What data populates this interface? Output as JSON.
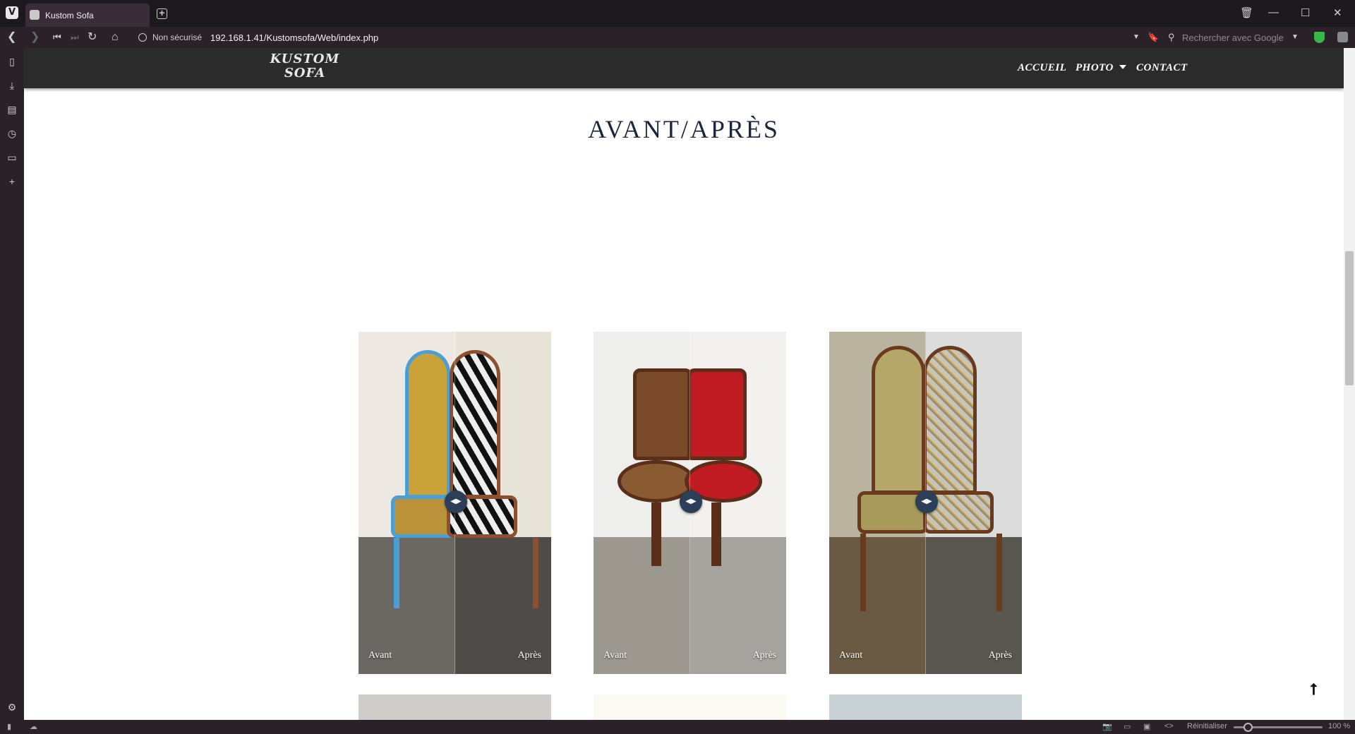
{
  "browser": {
    "tab_title": "Kustom Sofa",
    "new_tab_symbol": "+",
    "security_label": "Non sécurisé",
    "url": "192.168.1.41/Kustomsofa/Web/index.php",
    "search_placeholder": "Rechercher avec Google",
    "status": {
      "reset_label": "Réinitialiser",
      "zoom": "100 %"
    }
  },
  "site": {
    "logo_line1": "KUSTOM",
    "logo_line2": "SOFA",
    "nav": {
      "home": "ACCUEIL",
      "photo": "PHOTO",
      "contact": "CONTACT"
    },
    "heading": "AVANT/APRÈS",
    "cards": [
      {
        "before_label": "Avant",
        "after_label": "Après",
        "before_color": "#c9a23a",
        "after_color": "#1a1a1a"
      },
      {
        "before_label": "Avant",
        "after_label": "Après",
        "before_color": "#7a4a2a",
        "after_color": "#c01a22"
      },
      {
        "before_label": "Avant",
        "after_label": "Après",
        "before_color": "#b5a76a",
        "after_color": "#c9c4b5"
      }
    ],
    "back_to_top": "⭡"
  },
  "colors": {
    "header_bg": "#2b2b2b",
    "heading": "#1c2540",
    "handle": "#2c3e58",
    "browser_chrome": "#2a2129"
  }
}
